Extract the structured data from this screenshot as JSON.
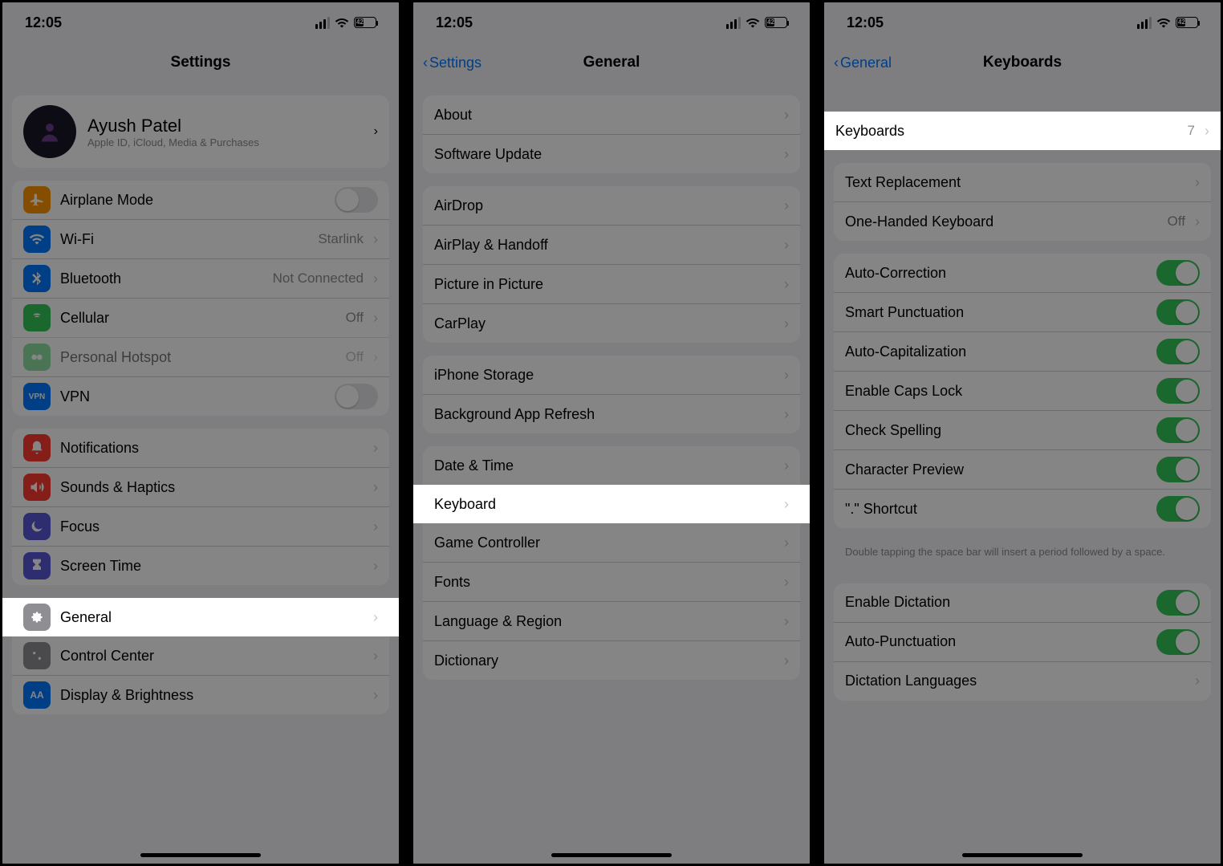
{
  "status": {
    "time": "12:05",
    "battery_pct": "42"
  },
  "screen1": {
    "title": "Settings",
    "profile": {
      "name": "Ayush Patel",
      "sub": "Apple ID, iCloud, Media & Purchases"
    },
    "group2": {
      "airplane": "Airplane Mode",
      "wifi": "Wi-Fi",
      "wifi_val": "Starlink",
      "bluetooth": "Bluetooth",
      "bluetooth_val": "Not Connected",
      "cellular": "Cellular",
      "cellular_val": "Off",
      "hotspot": "Personal Hotspot",
      "hotspot_val": "Off",
      "vpn": "VPN"
    },
    "group3": {
      "notifications": "Notifications",
      "sounds": "Sounds & Haptics",
      "focus": "Focus",
      "screentime": "Screen Time"
    },
    "group4": {
      "general": "General",
      "controlcenter": "Control Center",
      "display": "Display & Brightness"
    }
  },
  "screen2": {
    "back": "Settings",
    "title": "General",
    "group1": {
      "about": "About",
      "update": "Software Update"
    },
    "group2": {
      "airdrop": "AirDrop",
      "airplay": "AirPlay & Handoff",
      "pip": "Picture in Picture",
      "carplay": "CarPlay"
    },
    "group3": {
      "storage": "iPhone Storage",
      "bgrefresh": "Background App Refresh"
    },
    "group4": {
      "datetime": "Date & Time",
      "keyboard": "Keyboard",
      "gamecontroller": "Game Controller",
      "fonts": "Fonts",
      "language": "Language & Region",
      "dictionary": "Dictionary"
    }
  },
  "screen3": {
    "back": "General",
    "title": "Keyboards",
    "keyboards": {
      "label": "Keyboards",
      "count": "7"
    },
    "group2": {
      "textrepl": "Text Replacement",
      "onehanded": "One-Handed Keyboard",
      "onehanded_val": "Off"
    },
    "group3": {
      "autocorrect": "Auto-Correction",
      "smartpunct": "Smart Punctuation",
      "autocap": "Auto-Capitalization",
      "capslock": "Enable Caps Lock",
      "spellcheck": "Check Spelling",
      "charpreview": "Character Preview",
      "dotshortcut": "\".\" Shortcut"
    },
    "footer": "Double tapping the space bar will insert a period followed by a space.",
    "group4": {
      "dictation": "Enable Dictation",
      "autopunct": "Auto-Punctuation",
      "dictlang": "Dictation Languages"
    }
  }
}
